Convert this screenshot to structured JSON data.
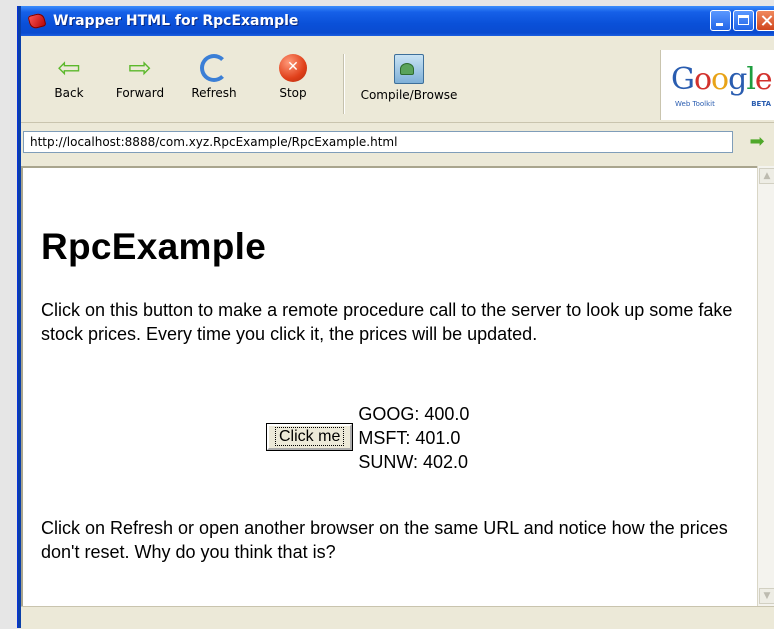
{
  "window": {
    "title": "Wrapper HTML for RpcExample"
  },
  "toolbar": {
    "back": "Back",
    "forward": "Forward",
    "refresh": "Refresh",
    "stop": "Stop",
    "compile": "Compile/Browse"
  },
  "logo": {
    "word": [
      "G",
      "o",
      "o",
      "g",
      "l",
      "e"
    ],
    "sub": "Web Toolkit",
    "beta": "BETA"
  },
  "address": {
    "url": "http://localhost:8888/com.xyz.RpcExample/RpcExample.html"
  },
  "page": {
    "heading": "RpcExample",
    "intro": "Click on this button to make a remote procedure call to the server to look up some fake stock prices. Every time you click it, the prices will be updated.",
    "button_label": "Click me",
    "prices": [
      "GOOG: 400.0",
      "MSFT: 401.0",
      "SUNW: 402.0"
    ],
    "outro": "Click on Refresh or open another browser on the same URL and notice how the prices don't reset. Why do you think that is?"
  },
  "icons": {
    "back": "back-arrow-icon",
    "forward": "forward-arrow-icon",
    "refresh": "refresh-icon",
    "stop": "stop-icon",
    "compile": "compile-browse-icon",
    "go": "go-arrow-icon"
  }
}
